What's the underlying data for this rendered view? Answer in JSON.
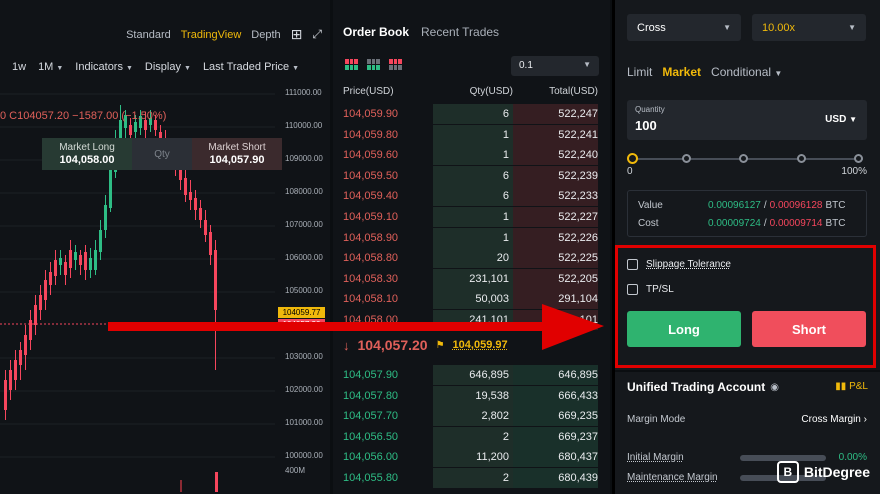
{
  "chart": {
    "views": [
      "Standard",
      "TradingView",
      "Depth"
    ],
    "toolbar": [
      "1w",
      "1M",
      "Indicators",
      "Display",
      "Last Traded Price"
    ],
    "ohlc_text": "0  C104057.20  −1587.00 (−1.50%)",
    "market_long_label": "Market Long",
    "market_long_price": "104,058.00",
    "qty_placeholder": "Qty",
    "market_short_label": "Market Short",
    "market_short_price": "104,057.90",
    "price_axis": [
      "111000.00",
      "110000.00",
      "109000.00",
      "108000.00",
      "107000.00",
      "106000.00",
      "105000.00",
      "103000.00",
      "102000.00",
      "101000.00",
      "100000.00",
      "400M"
    ],
    "tag_last": "104059.77",
    "tag_mark": "104057.20",
    "colors": {
      "up": "#2ebd85",
      "down": "#f6465d"
    }
  },
  "orderbook": {
    "tabs": [
      "Order Book",
      "Recent Trades"
    ],
    "precision": "0.1",
    "headers": [
      "Price(USD)",
      "Qty(USD)",
      "Total(USD)"
    ],
    "asks": [
      [
        "104,059.90",
        "6",
        "522,247"
      ],
      [
        "104,059.80",
        "1",
        "522,241"
      ],
      [
        "104,059.60",
        "1",
        "522,240"
      ],
      [
        "104,059.50",
        "6",
        "522,239"
      ],
      [
        "104,059.40",
        "6",
        "522,233"
      ],
      [
        "104,059.10",
        "1",
        "522,227"
      ],
      [
        "104,058.90",
        "1",
        "522,226"
      ],
      [
        "104,058.80",
        "20",
        "522,225"
      ],
      [
        "104,058.30",
        "231,101",
        "522,205"
      ],
      [
        "104,058.10",
        "50,003",
        "291,104"
      ],
      [
        "104,058.00",
        "241,101",
        "241,101"
      ]
    ],
    "last_price": "104,057.20",
    "mark_price": "104,059.97",
    "bids": [
      [
        "104,057.90",
        "646,895",
        "646,895"
      ],
      [
        "104,057.80",
        "19,538",
        "666,433"
      ],
      [
        "104,057.70",
        "2,802",
        "669,235"
      ],
      [
        "104,056.50",
        "2",
        "669,237"
      ],
      [
        "104,056.00",
        "11,200",
        "680,437"
      ],
      [
        "104,055.80",
        "2",
        "680,439"
      ]
    ]
  },
  "trade": {
    "margin_type": "Cross",
    "leverage": "10.00x",
    "order_tabs": [
      "Limit",
      "Market",
      "Conditional"
    ],
    "quantity_label": "Quantity",
    "quantity_value": "100",
    "quantity_currency": "USD",
    "slider_min": "0",
    "slider_max": "100%",
    "slider_percent": 0,
    "value_label": "Value",
    "value_long": "0.00096127",
    "value_short": "0.00096128",
    "value_unit": "BTC",
    "cost_label": "Cost",
    "cost_long": "0.00009724",
    "cost_short": "0.00009714",
    "cost_unit": "BTC",
    "slippage_label": "Slippage Tolerance",
    "tpsl_label": "TP/SL",
    "long_button": "Long",
    "short_button": "Short",
    "uta_title": "Unified Trading Account",
    "pnl_label": "P&L",
    "margin_mode_label": "Margin Mode",
    "margin_mode_value": "Cross Margin",
    "initial_margin_label": "Initial Margin",
    "initial_margin_value": "0.00%",
    "maintenance_margin_label": "Maintenance Margin",
    "brand": "BitDegree"
  }
}
